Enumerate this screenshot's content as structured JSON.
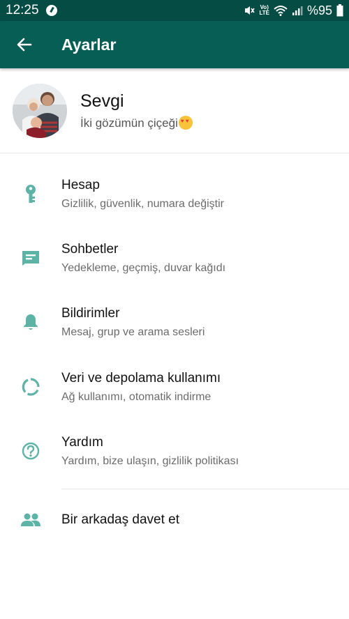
{
  "status_bar": {
    "time": "12:25",
    "volte_top": "Vo)",
    "volte_bottom": "LTE",
    "battery": "%95"
  },
  "app_bar": {
    "title": "Ayarlar"
  },
  "profile": {
    "name": "Sevgi",
    "status": "İki gözümün çiçeği"
  },
  "menu": [
    {
      "title": "Hesap",
      "subtitle": "Gizlilik, güvenlik, numara değiştir",
      "icon": "key-icon"
    },
    {
      "title": "Sohbetler",
      "subtitle": "Yedekleme, geçmiş, duvar kağıdı",
      "icon": "chat-icon"
    },
    {
      "title": "Bildirimler",
      "subtitle": "Mesaj, grup ve arama sesleri",
      "icon": "bell-icon"
    },
    {
      "title": "Veri ve depolama kullanımı",
      "subtitle": "Ağ kullanımı, otomatik indirme",
      "icon": "data-usage-icon"
    },
    {
      "title": "Yardım",
      "subtitle": "Yardım, bize ulaşın, gizlilik politikası",
      "icon": "help-icon"
    }
  ],
  "invite": {
    "title": "Bir arkadaş davet et",
    "icon": "people-icon"
  },
  "colors": {
    "status_bar": "#054d44",
    "app_bar": "#075e54",
    "icon": "#5cb3a6"
  }
}
